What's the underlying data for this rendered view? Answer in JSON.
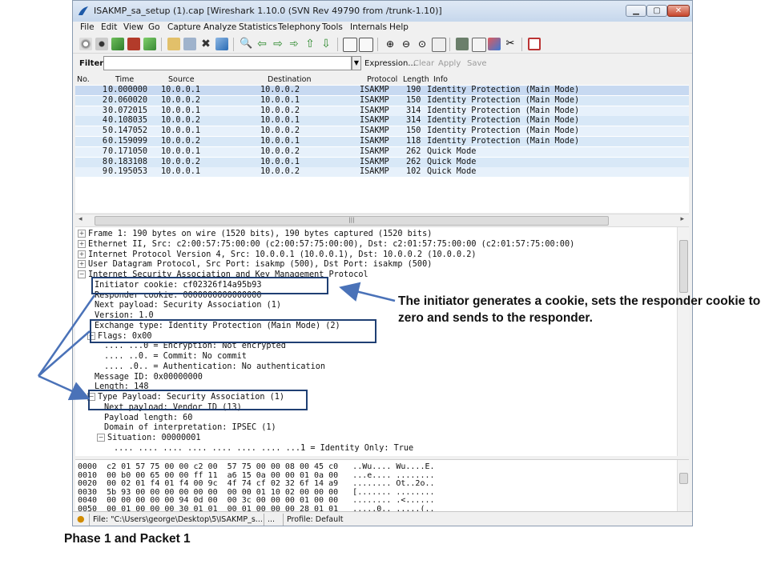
{
  "window": {
    "title": "ISAKMP_sa_setup (1).cap   [Wireshark 1.10.0  (SVN Rev 49790 from /trunk-1.10)]"
  },
  "menu": [
    "File",
    "Edit",
    "View",
    "Go",
    "Capture",
    "Analyze",
    "Statistics",
    "Telephony",
    "Tools",
    "Internals",
    "Help"
  ],
  "filter": {
    "label": "Filter:",
    "value": "",
    "buttons": [
      "Expression...",
      "Clear",
      "Apply",
      "Save"
    ]
  },
  "packet_list": {
    "columns": [
      "No.",
      "Time",
      "Source",
      "Destination",
      "Protocol",
      "Length",
      "Info"
    ],
    "rows": [
      {
        "no": "1",
        "time": "0.000000",
        "src": "10.0.0.1",
        "dst": "10.0.0.2",
        "proto": "ISAKMP",
        "len": "190",
        "info": "Identity Protection (Main Mode)"
      },
      {
        "no": "2",
        "time": "0.060020",
        "src": "10.0.0.2",
        "dst": "10.0.0.1",
        "proto": "ISAKMP",
        "len": "150",
        "info": "Identity Protection (Main Mode)"
      },
      {
        "no": "3",
        "time": "0.072015",
        "src": "10.0.0.1",
        "dst": "10.0.0.2",
        "proto": "ISAKMP",
        "len": "314",
        "info": "Identity Protection (Main Mode)"
      },
      {
        "no": "4",
        "time": "0.108035",
        "src": "10.0.0.2",
        "dst": "10.0.0.1",
        "proto": "ISAKMP",
        "len": "314",
        "info": "Identity Protection (Main Mode)"
      },
      {
        "no": "5",
        "time": "0.147052",
        "src": "10.0.0.1",
        "dst": "10.0.0.2",
        "proto": "ISAKMP",
        "len": "150",
        "info": "Identity Protection (Main Mode)"
      },
      {
        "no": "6",
        "time": "0.159099",
        "src": "10.0.0.2",
        "dst": "10.0.0.1",
        "proto": "ISAKMP",
        "len": "118",
        "info": "Identity Protection (Main Mode)"
      },
      {
        "no": "7",
        "time": "0.171050",
        "src": "10.0.0.1",
        "dst": "10.0.0.2",
        "proto": "ISAKMP",
        "len": "262",
        "info": "Quick Mode"
      },
      {
        "no": "8",
        "time": "0.183108",
        "src": "10.0.0.2",
        "dst": "10.0.0.1",
        "proto": "ISAKMP",
        "len": "262",
        "info": "Quick Mode"
      },
      {
        "no": "9",
        "time": "0.195053",
        "src": "10.0.0.1",
        "dst": "10.0.0.2",
        "proto": "ISAKMP",
        "len": "102",
        "info": "Quick Mode"
      }
    ],
    "colors": {
      "selected": "#c7d9f1",
      "row_a": "#e7f1fb",
      "row_b": "#d8e8f7"
    }
  },
  "details": [
    {
      "exp": "+",
      "text": "Frame 1: 190 bytes on wire (1520 bits), 190 bytes captured (1520 bits)"
    },
    {
      "exp": "+",
      "text": "Ethernet II, Src: c2:00:57:75:00:00 (c2:00:57:75:00:00), Dst: c2:01:57:75:00:00 (c2:01:57:75:00:00)"
    },
    {
      "exp": "+",
      "text": "Internet Protocol Version 4, Src: 10.0.0.1 (10.0.0.1), Dst: 10.0.0.2 (10.0.0.2)"
    },
    {
      "exp": "+",
      "text": "User Datagram Protocol, Src Port: isakmp (500), Dst Port: isakmp (500)"
    },
    {
      "exp": "−",
      "text": "Internet Security Association and Key Management Protocol"
    },
    {
      "exp": "",
      "text": "Initiator cookie: cf02326f14a95b93"
    },
    {
      "exp": "",
      "text": "Responder cookie: 0000000000000000"
    },
    {
      "exp": "",
      "text": "Next payload: Security Association (1)"
    },
    {
      "exp": "",
      "text": "Version: 1.0"
    },
    {
      "exp": "",
      "text": "Exchange type: Identity Protection (Main Mode) (2)"
    },
    {
      "exp": "−",
      "text": "Flags: 0x00"
    },
    {
      "exp": "",
      "text": ".... ...0 = Encryption: Not encrypted"
    },
    {
      "exp": "",
      "text": ".... ..0. = Commit: No commit"
    },
    {
      "exp": "",
      "text": ".... .0.. = Authentication: No authentication"
    },
    {
      "exp": "",
      "text": "Message ID: 0x00000000"
    },
    {
      "exp": "",
      "text": "Length: 148"
    },
    {
      "exp": "−",
      "text": "Type Payload: Security Association (1)"
    },
    {
      "exp": "",
      "text": "Next payload: Vendor ID (13)"
    },
    {
      "exp": "",
      "text": "Payload length: 60"
    },
    {
      "exp": "",
      "text": "Domain of interpretation: IPSEC (1)"
    },
    {
      "exp": "−",
      "text": "Situation: 00000001"
    },
    {
      "exp": "",
      "text": ".... .... .... .... .... .... .... ...1 = Identity Only: True"
    }
  ],
  "hex": [
    "0000  c2 01 57 75 00 00 c2 00  57 75 00 00 08 00 45 c0   ..Wu.... Wu....E.",
    "0010  00 b0 00 65 00 00 ff 11  a6 15 0a 00 00 01 0a 00   ...e.... ........",
    "0020  00 02 01 f4 01 f4 00 9c  4f 74 cf 02 32 6f 14 a9   ........ Ot..2o..",
    "0030  5b 93 00 00 00 00 00 00  00 00 01 10 02 00 00 00   [....... ........",
    "0040  00 00 00 00 00 94 0d 00  00 3c 00 00 00 01 00 00   ........ .<......",
    "0050  00 01 00 00 00 30 01 01  00 01 00 00 00 28 01 01   .....0.. .....(.."
  ],
  "status": {
    "file": "File: \"C:\\Users\\george\\Desktop\\5\\ISAKMP_s...",
    "middle": "...",
    "profile": "Profile: Default"
  },
  "annotation": {
    "callout": "The initiator generates a cookie, sets the responder cookie to zero and sends to the responder.",
    "caption": "Phase 1 and Packet 1",
    "box_color": "#1f3f73",
    "arrow_color": "#4a72b8"
  }
}
